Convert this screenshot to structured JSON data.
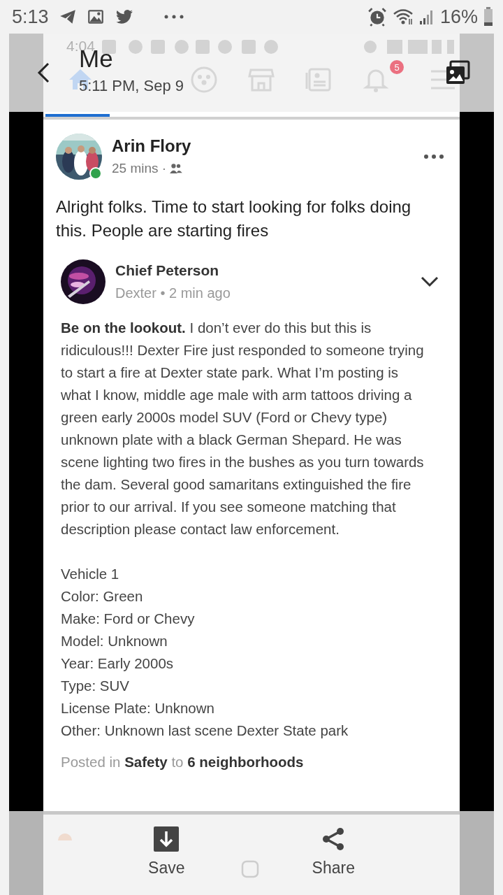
{
  "status_bar": {
    "time": "5:13",
    "battery": "16%"
  },
  "viewer": {
    "title": "Me",
    "subtitle": "5:11 PM, Sep 9"
  },
  "screenshot": {
    "status_time": "4:04",
    "nav": [
      {
        "kind": "home",
        "selected": true
      },
      {
        "kind": "groups",
        "selected": false
      },
      {
        "kind": "store",
        "selected": false
      },
      {
        "kind": "news",
        "selected": false
      },
      {
        "kind": "bell",
        "selected": false,
        "badge": "5"
      },
      {
        "kind": "menu",
        "selected": false
      }
    ],
    "post": {
      "author": "Arin Flory",
      "time": "25 mins ·",
      "online": true,
      "text": "Alright folks. Time to start looking for folks doing this. People are starting fires",
      "shared": {
        "author": "Chief Peterson",
        "meta": "Dexter • 2 min ago",
        "body": "**Be on the lookout.** I don’t ever do this but this is ridiculous!!! Dexter Fire just responded to someone trying to start a fire at Dexter state park. What I’m posting is what I know, middle age male with arm tattoos driving a green early 2000s model SUV (Ford or Chevy type) unknown plate with a black German Shepard. He was scene lighting two fires in the bushes as you turn towards the dam. Several good samaritans extinguished the fire prior to our arrival. If you see someone matching that description please contact law enforcement.",
        "details": [
          "Vehicle 1",
          "Color: Green",
          "Make: Ford or Chevy",
          "Model: Unknown",
          "Year: Early 2000s",
          "Type: SUV",
          "License Plate: Unknown",
          "Other: Unknown last scene Dexter State park"
        ],
        "footer": "Posted in **Safety** to **6 neighborhoods**"
      }
    }
  },
  "actions": [
    {
      "kind": "save",
      "label": "Save"
    },
    {
      "kind": "share",
      "label": "Share"
    }
  ]
}
